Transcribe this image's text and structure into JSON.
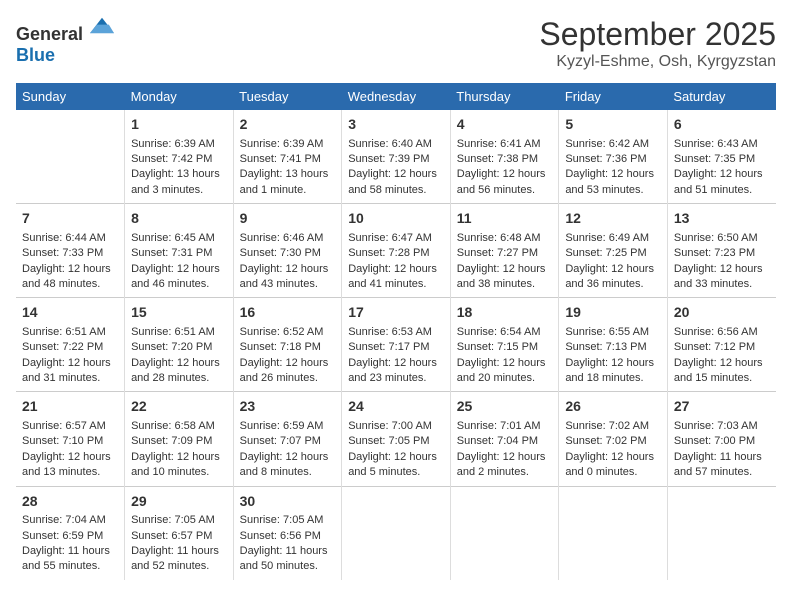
{
  "header": {
    "logo_general": "General",
    "logo_blue": "Blue",
    "month": "September 2025",
    "location": "Kyzyl-Eshme, Osh, Kyrgyzstan"
  },
  "days_of_week": [
    "Sunday",
    "Monday",
    "Tuesday",
    "Wednesday",
    "Thursday",
    "Friday",
    "Saturday"
  ],
  "weeks": [
    [
      {
        "day": "",
        "sunrise": "",
        "sunset": "",
        "daylight": ""
      },
      {
        "day": "1",
        "sunrise": "Sunrise: 6:39 AM",
        "sunset": "Sunset: 7:42 PM",
        "daylight": "Daylight: 13 hours and 3 minutes."
      },
      {
        "day": "2",
        "sunrise": "Sunrise: 6:39 AM",
        "sunset": "Sunset: 7:41 PM",
        "daylight": "Daylight: 13 hours and 1 minute."
      },
      {
        "day": "3",
        "sunrise": "Sunrise: 6:40 AM",
        "sunset": "Sunset: 7:39 PM",
        "daylight": "Daylight: 12 hours and 58 minutes."
      },
      {
        "day": "4",
        "sunrise": "Sunrise: 6:41 AM",
        "sunset": "Sunset: 7:38 PM",
        "daylight": "Daylight: 12 hours and 56 minutes."
      },
      {
        "day": "5",
        "sunrise": "Sunrise: 6:42 AM",
        "sunset": "Sunset: 7:36 PM",
        "daylight": "Daylight: 12 hours and 53 minutes."
      },
      {
        "day": "6",
        "sunrise": "Sunrise: 6:43 AM",
        "sunset": "Sunset: 7:35 PM",
        "daylight": "Daylight: 12 hours and 51 minutes."
      }
    ],
    [
      {
        "day": "7",
        "sunrise": "Sunrise: 6:44 AM",
        "sunset": "Sunset: 7:33 PM",
        "daylight": "Daylight: 12 hours and 48 minutes."
      },
      {
        "day": "8",
        "sunrise": "Sunrise: 6:45 AM",
        "sunset": "Sunset: 7:31 PM",
        "daylight": "Daylight: 12 hours and 46 minutes."
      },
      {
        "day": "9",
        "sunrise": "Sunrise: 6:46 AM",
        "sunset": "Sunset: 7:30 PM",
        "daylight": "Daylight: 12 hours and 43 minutes."
      },
      {
        "day": "10",
        "sunrise": "Sunrise: 6:47 AM",
        "sunset": "Sunset: 7:28 PM",
        "daylight": "Daylight: 12 hours and 41 minutes."
      },
      {
        "day": "11",
        "sunrise": "Sunrise: 6:48 AM",
        "sunset": "Sunset: 7:27 PM",
        "daylight": "Daylight: 12 hours and 38 minutes."
      },
      {
        "day": "12",
        "sunrise": "Sunrise: 6:49 AM",
        "sunset": "Sunset: 7:25 PM",
        "daylight": "Daylight: 12 hours and 36 minutes."
      },
      {
        "day": "13",
        "sunrise": "Sunrise: 6:50 AM",
        "sunset": "Sunset: 7:23 PM",
        "daylight": "Daylight: 12 hours and 33 minutes."
      }
    ],
    [
      {
        "day": "14",
        "sunrise": "Sunrise: 6:51 AM",
        "sunset": "Sunset: 7:22 PM",
        "daylight": "Daylight: 12 hours and 31 minutes."
      },
      {
        "day": "15",
        "sunrise": "Sunrise: 6:51 AM",
        "sunset": "Sunset: 7:20 PM",
        "daylight": "Daylight: 12 hours and 28 minutes."
      },
      {
        "day": "16",
        "sunrise": "Sunrise: 6:52 AM",
        "sunset": "Sunset: 7:18 PM",
        "daylight": "Daylight: 12 hours and 26 minutes."
      },
      {
        "day": "17",
        "sunrise": "Sunrise: 6:53 AM",
        "sunset": "Sunset: 7:17 PM",
        "daylight": "Daylight: 12 hours and 23 minutes."
      },
      {
        "day": "18",
        "sunrise": "Sunrise: 6:54 AM",
        "sunset": "Sunset: 7:15 PM",
        "daylight": "Daylight: 12 hours and 20 minutes."
      },
      {
        "day": "19",
        "sunrise": "Sunrise: 6:55 AM",
        "sunset": "Sunset: 7:13 PM",
        "daylight": "Daylight: 12 hours and 18 minutes."
      },
      {
        "day": "20",
        "sunrise": "Sunrise: 6:56 AM",
        "sunset": "Sunset: 7:12 PM",
        "daylight": "Daylight: 12 hours and 15 minutes."
      }
    ],
    [
      {
        "day": "21",
        "sunrise": "Sunrise: 6:57 AM",
        "sunset": "Sunset: 7:10 PM",
        "daylight": "Daylight: 12 hours and 13 minutes."
      },
      {
        "day": "22",
        "sunrise": "Sunrise: 6:58 AM",
        "sunset": "Sunset: 7:09 PM",
        "daylight": "Daylight: 12 hours and 10 minutes."
      },
      {
        "day": "23",
        "sunrise": "Sunrise: 6:59 AM",
        "sunset": "Sunset: 7:07 PM",
        "daylight": "Daylight: 12 hours and 8 minutes."
      },
      {
        "day": "24",
        "sunrise": "Sunrise: 7:00 AM",
        "sunset": "Sunset: 7:05 PM",
        "daylight": "Daylight: 12 hours and 5 minutes."
      },
      {
        "day": "25",
        "sunrise": "Sunrise: 7:01 AM",
        "sunset": "Sunset: 7:04 PM",
        "daylight": "Daylight: 12 hours and 2 minutes."
      },
      {
        "day": "26",
        "sunrise": "Sunrise: 7:02 AM",
        "sunset": "Sunset: 7:02 PM",
        "daylight": "Daylight: 12 hours and 0 minutes."
      },
      {
        "day": "27",
        "sunrise": "Sunrise: 7:03 AM",
        "sunset": "Sunset: 7:00 PM",
        "daylight": "Daylight: 11 hours and 57 minutes."
      }
    ],
    [
      {
        "day": "28",
        "sunrise": "Sunrise: 7:04 AM",
        "sunset": "Sunset: 6:59 PM",
        "daylight": "Daylight: 11 hours and 55 minutes."
      },
      {
        "day": "29",
        "sunrise": "Sunrise: 7:05 AM",
        "sunset": "Sunset: 6:57 PM",
        "daylight": "Daylight: 11 hours and 52 minutes."
      },
      {
        "day": "30",
        "sunrise": "Sunrise: 7:05 AM",
        "sunset": "Sunset: 6:56 PM",
        "daylight": "Daylight: 11 hours and 50 minutes."
      },
      {
        "day": "",
        "sunrise": "",
        "sunset": "",
        "daylight": ""
      },
      {
        "day": "",
        "sunrise": "",
        "sunset": "",
        "daylight": ""
      },
      {
        "day": "",
        "sunrise": "",
        "sunset": "",
        "daylight": ""
      },
      {
        "day": "",
        "sunrise": "",
        "sunset": "",
        "daylight": ""
      }
    ]
  ]
}
